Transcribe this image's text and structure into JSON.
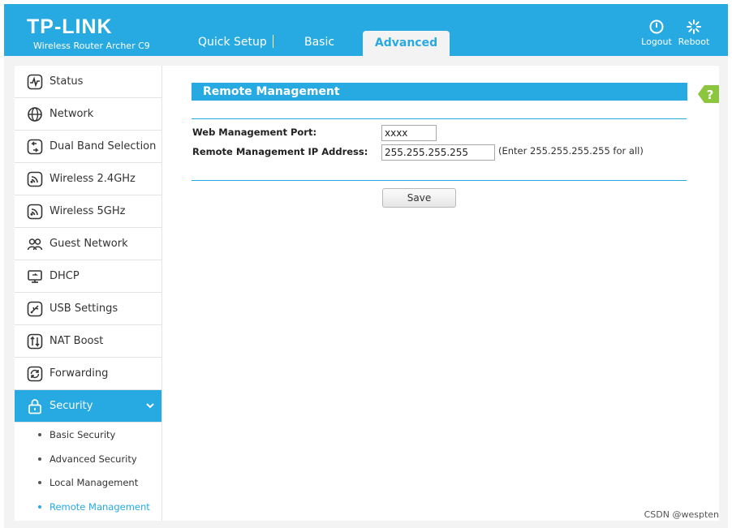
{
  "header": {
    "brand": "TP-LINK",
    "model": "Wireless Router Archer C9",
    "tabs": [
      {
        "label": "Quick Setup"
      },
      {
        "label": "Basic"
      },
      {
        "label": "Advanced"
      }
    ],
    "logout_label": "Logout",
    "reboot_label": "Reboot"
  },
  "sidebar": {
    "items": [
      {
        "label": "Status",
        "icon": "status-icon"
      },
      {
        "label": "Network",
        "icon": "globe-icon"
      },
      {
        "label": "Dual Band Selection",
        "icon": "dual-band-icon"
      },
      {
        "label": "Wireless 2.4GHz",
        "icon": "wifi-icon"
      },
      {
        "label": "Wireless 5GHz",
        "icon": "wifi-icon"
      },
      {
        "label": "Guest Network",
        "icon": "guest-icon"
      },
      {
        "label": "DHCP",
        "icon": "monitor-icon"
      },
      {
        "label": "USB Settings",
        "icon": "usb-icon"
      },
      {
        "label": "NAT Boost",
        "icon": "nat-icon"
      },
      {
        "label": "Forwarding",
        "icon": "forwarding-icon"
      },
      {
        "label": "Security",
        "icon": "lock-icon"
      }
    ],
    "sub_items": [
      {
        "label": "Basic Security"
      },
      {
        "label": "Advanced Security"
      },
      {
        "label": "Local Management"
      },
      {
        "label": "Remote Management"
      }
    ]
  },
  "main": {
    "section_title": "Remote Management",
    "help_label": "?",
    "form": {
      "port_label": "Web Management Port:",
      "port_value": "xxxx",
      "ip_label": "Remote Management IP Address:",
      "ip_value": "255.255.255.255",
      "ip_hint": "(Enter 255.255.255.255 for all)"
    },
    "save_label": "Save"
  },
  "watermark": "CSDN @wespten",
  "colors": {
    "accent": "#27a9e1",
    "background": "#f3f3f3"
  }
}
